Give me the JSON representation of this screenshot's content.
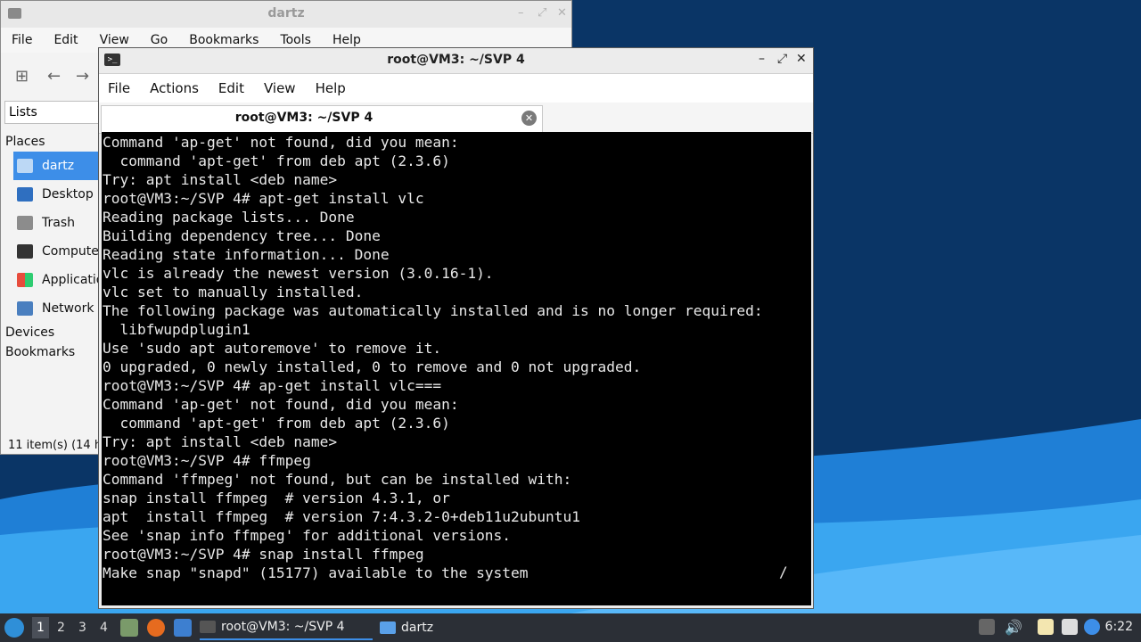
{
  "file_manager": {
    "title": "dartz",
    "menu": [
      "File",
      "Edit",
      "View",
      "Go",
      "Bookmarks",
      "Tools",
      "Help"
    ],
    "side_panel_mode": "Lists",
    "places_label": "Places",
    "places": [
      "dartz",
      "Desktop",
      "Trash",
      "Compute",
      "Applicatio",
      "Network"
    ],
    "devices_label": "Devices",
    "bookmarks_label": "Bookmarks",
    "status": "11 item(s) (14 h"
  },
  "terminal": {
    "title": "root@VM3: ~/SVP 4",
    "menu": [
      "File",
      "Actions",
      "Edit",
      "View",
      "Help"
    ],
    "tab_label": "root@VM3: ~/SVP 4",
    "output": "Command 'ap-get' not found, did you mean:\n  command 'apt-get' from deb apt (2.3.6)\nTry: apt install <deb name>\nroot@VM3:~/SVP 4# apt-get install vlc\nReading package lists... Done\nBuilding dependency tree... Done\nReading state information... Done\nvlc is already the newest version (3.0.16-1).\nvlc set to manually installed.\nThe following package was automatically installed and is no longer required:\n  libfwupdplugin1\nUse 'sudo apt autoremove' to remove it.\n0 upgraded, 0 newly installed, 0 to remove and 0 not upgraded.\nroot@VM3:~/SVP 4# ap-get install vlc===\nCommand 'ap-get' not found, did you mean:\n  command 'apt-get' from deb apt (2.3.6)\nTry: apt install <deb name>\nroot@VM3:~/SVP 4# ffmpeg\nCommand 'ffmpeg' not found, but can be installed with:\nsnap install ffmpeg  # version 4.3.1, or\napt  install ffmpeg  # version 7:4.3.2-0+deb11u2ubuntu1\nSee 'snap info ffmpeg' for additional versions.\nroot@VM3:~/SVP 4# snap install ffmpeg\nMake snap \"snapd\" (15177) available to the system",
    "spinner": "/"
  },
  "taskbar": {
    "workspaces": [
      "1",
      "2",
      "3",
      "4"
    ],
    "tasks": [
      "root@VM3: ~/SVP 4",
      "dartz"
    ],
    "clock": "6:22"
  },
  "colors": {
    "accent": "#3d8ee8",
    "terminal_bg": "#000000",
    "taskbar_bg": "#2b2f36"
  }
}
